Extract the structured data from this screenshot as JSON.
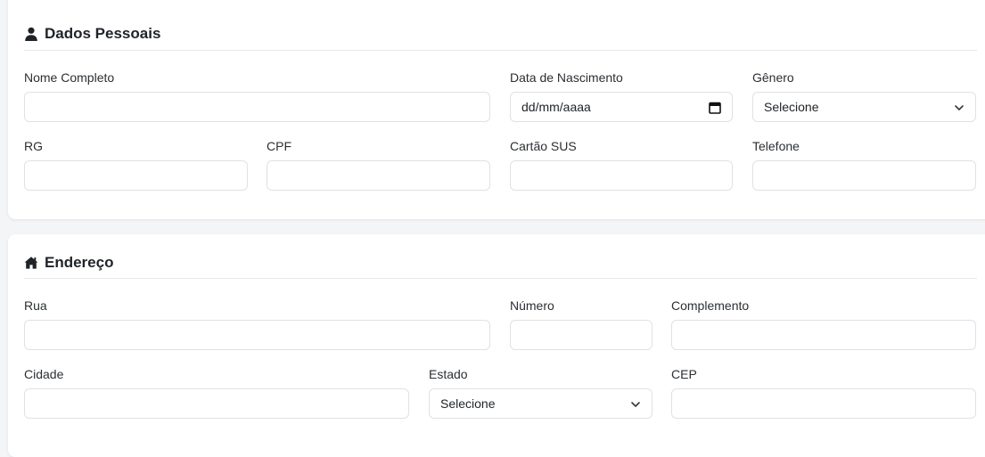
{
  "personal": {
    "title": "Dados Pessoais",
    "icon": "user-icon",
    "fields": {
      "nome": {
        "label": "Nome Completo",
        "value": ""
      },
      "nascimento": {
        "label": "Data de Nascimento",
        "placeholder": "dd/mm/aaaa"
      },
      "genero": {
        "label": "Gênero",
        "selected": "Selecione"
      },
      "rg": {
        "label": "RG",
        "value": ""
      },
      "cpf": {
        "label": "CPF",
        "value": ""
      },
      "sus": {
        "label": "Cartão SUS",
        "value": ""
      },
      "telefone": {
        "label": "Telefone",
        "value": ""
      }
    }
  },
  "address": {
    "title": "Endereço",
    "icon": "home-icon",
    "fields": {
      "rua": {
        "label": "Rua",
        "value": ""
      },
      "numero": {
        "label": "Número",
        "value": ""
      },
      "complemento": {
        "label": "Complemento",
        "value": ""
      },
      "cidade": {
        "label": "Cidade",
        "value": ""
      },
      "estado": {
        "label": "Estado",
        "selected": "Selecione"
      },
      "cep": {
        "label": "CEP",
        "value": ""
      }
    }
  }
}
